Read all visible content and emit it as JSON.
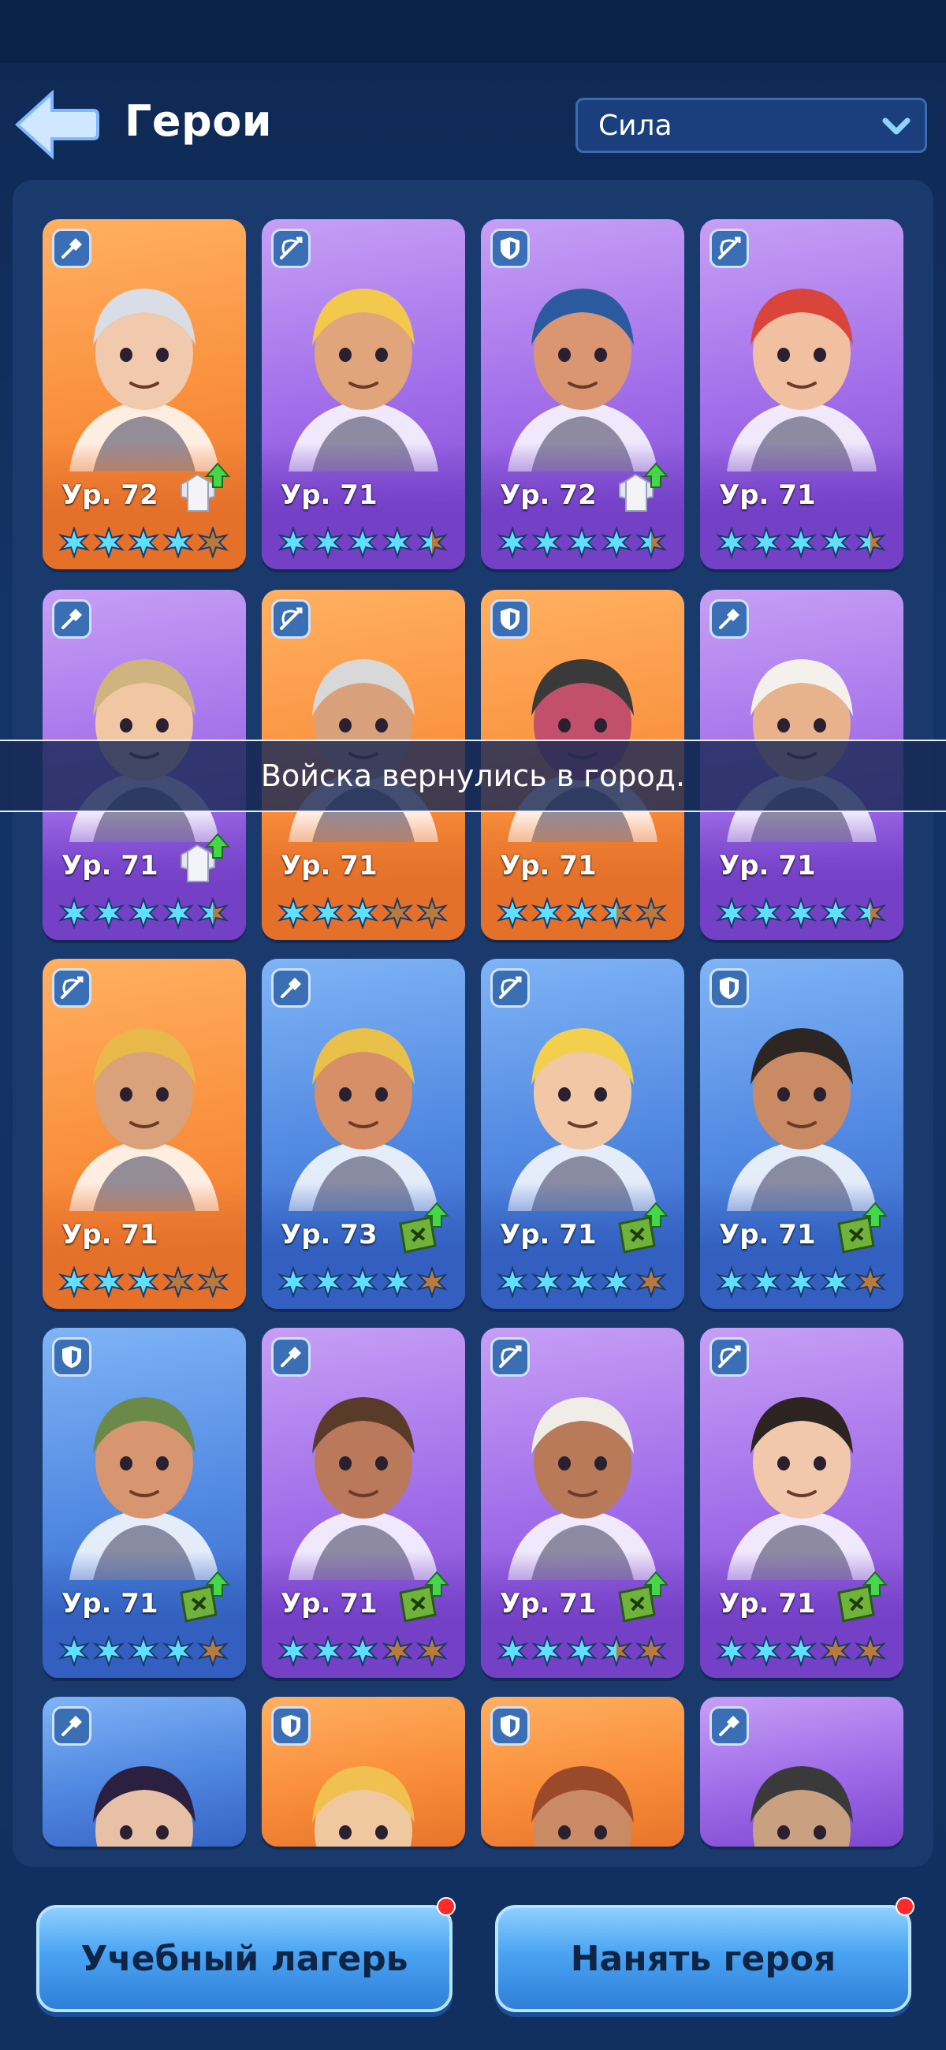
{
  "header": {
    "title": "Герои",
    "sort_label": "Сила"
  },
  "toast": "Войска вернулись в город.",
  "level_prefix": "Ур.",
  "colors": {
    "orange": "#f98e3b",
    "purple": "#9e6ae8",
    "blue": "#4f86e0",
    "star_active": "#5fe0ff",
    "star_inactive": "#b97a3e"
  },
  "heroes": [
    {
      "level": "72",
      "bg": "orange",
      "type": "shovel",
      "stars": 4,
      "upgrade": "coat",
      "skin": "#f1c9ac",
      "hair": "#d8dde6"
    },
    {
      "level": "71",
      "bg": "purple",
      "type": "crossbow",
      "stars": 4.5,
      "upgrade": "none",
      "skin": "#e0a57a",
      "hair": "#f2c94c"
    },
    {
      "level": "72",
      "bg": "purple",
      "type": "shield",
      "stars": 4.5,
      "upgrade": "coat",
      "skin": "#d99670",
      "hair": "#2b5aa0"
    },
    {
      "level": "71",
      "bg": "purple",
      "type": "crossbow",
      "stars": 4.5,
      "upgrade": "none",
      "skin": "#f0c0a0",
      "hair": "#d9443b"
    },
    {
      "level": "71",
      "bg": "purple",
      "type": "shovel",
      "stars": 4.5,
      "upgrade": "coat",
      "skin": "#f1c6a3",
      "hair": "#d0b480"
    },
    {
      "level": "71",
      "bg": "orange",
      "type": "crossbow",
      "stars": 3,
      "upgrade": "none",
      "skin": "#d9a07c",
      "hair": "#d8d8d8"
    },
    {
      "level": "71",
      "bg": "orange",
      "type": "shield",
      "stars": 3.5,
      "upgrade": "none",
      "skin": "#c2506a",
      "hair": "#3a3a3a"
    },
    {
      "level": "71",
      "bg": "purple",
      "type": "shovel",
      "stars": 4.5,
      "upgrade": "none",
      "skin": "#e8b28c",
      "hair": "#f4f1ec"
    },
    {
      "level": "71",
      "bg": "orange",
      "type": "crossbow",
      "stars": 3,
      "upgrade": "none",
      "skin": "#d9a27a",
      "hair": "#e8b84a"
    },
    {
      "level": "73",
      "bg": "blue",
      "type": "shovel",
      "stars": 4,
      "upgrade": "book",
      "skin": "#d68f66",
      "hair": "#e8c04a"
    },
    {
      "level": "71",
      "bg": "blue",
      "type": "crossbow",
      "stars": 4,
      "upgrade": "book",
      "skin": "#f2c7a5",
      "hair": "#f3cf4e"
    },
    {
      "level": "71",
      "bg": "blue",
      "type": "shield",
      "stars": 4,
      "upgrade": "book",
      "skin": "#c98a64",
      "hair": "#2d2622"
    },
    {
      "level": "71",
      "bg": "blue",
      "type": "shield",
      "stars": 4,
      "upgrade": "book",
      "skin": "#d89670",
      "hair": "#6b8a4a"
    },
    {
      "level": "71",
      "bg": "purple",
      "type": "shovel",
      "stars": 3,
      "upgrade": "book",
      "skin": "#b9795a",
      "hair": "#5a3a28"
    },
    {
      "level": "71",
      "bg": "purple",
      "type": "crossbow",
      "stars": 3.5,
      "upgrade": "book",
      "skin": "#b87a58",
      "hair": "#f0ece6"
    },
    {
      "level": "71",
      "bg": "purple",
      "type": "crossbow",
      "stars": 3,
      "upgrade": "book",
      "skin": "#f2c8ac",
      "hair": "#2b2420"
    }
  ],
  "partial_heroes": [
    {
      "bg": "blue",
      "type": "shovel",
      "skin": "#e8c0a6",
      "hair": "#2b2040"
    },
    {
      "bg": "orange",
      "type": "shield",
      "skin": "#f0c8a0",
      "hair": "#f0c050"
    },
    {
      "bg": "orange",
      "type": "shield",
      "skin": "#c98a64",
      "hair": "#9a4a2a"
    },
    {
      "bg": "purple",
      "type": "shovel",
      "skin": "#c9a080",
      "hair": "#3a3a3a"
    }
  ],
  "buttons": {
    "camp": "Учебный лагерь",
    "hire": "Нанять героя"
  }
}
